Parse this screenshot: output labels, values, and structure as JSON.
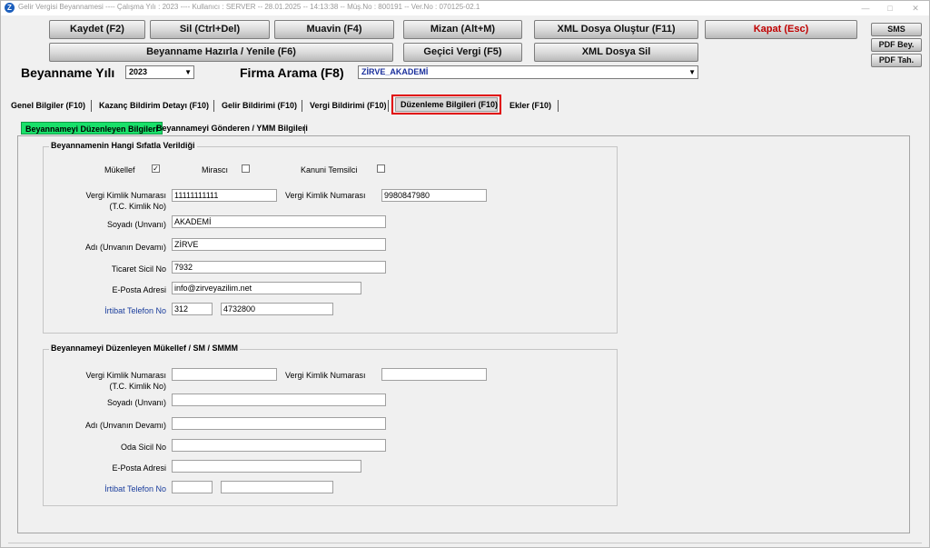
{
  "window": {
    "title": "Gelir Vergisi Beyannamesi  ----  Çalışma Yılı : 2023  ----  Kullanıcı : SERVER -- 28.01.2025 -- 14:13:38 -- Müş.No : 800191 -- Ver.No : 070125-02.1",
    "app_icon": "Z"
  },
  "toolbar": {
    "save": "Kaydet (F2)",
    "delete": "Sil (Ctrl+Del)",
    "muavin": "Muavin (F4)",
    "mizan": "Mizan (Alt+M)",
    "xml_create": "XML Dosya Oluştur (F11)",
    "close": "Kapat (Esc)",
    "prepare": "Beyanname Hazırla / Yenile (F6)",
    "temp_tax": "Geçici Vergi (F5)",
    "xml_delete": "XML Dosya Sil",
    "sms": "SMS",
    "pdf_bey": "PDF Bey.",
    "pdf_tah": "PDF Tah."
  },
  "filters": {
    "year_label": "Beyanname Yılı",
    "year_value": "2023",
    "company_label": "Firma Arama (F8)",
    "company_value": "ZİRVE_AKADEMİ"
  },
  "tabs": [
    "Genel Bilgiler (F10)",
    "Kazanç Bildirim Detayı (F10)",
    "Gelir Bildirimi (F10)",
    "Vergi Bildirimi (F10)",
    "Düzenleme Bilgileri (F10)",
    "Ekler (F10)"
  ],
  "subtabs": [
    "Beyannameyi Düzenleyen Bilgileri",
    "Beyannameyi Gönderen / YMM Bilgileri"
  ],
  "group1": {
    "title": "Beyannamenin Hangi Sıfatla Verildiği",
    "cb_mukellef": "Mükellef",
    "cb_mirasci": "Mirascı",
    "cb_kanuni": "Kanuni Temsilci",
    "mukellef_checked": "✓",
    "vkn_label": "Vergi Kimlik Numarası\n(T.C. Kimlik No)",
    "vkn_label_1": "Vergi Kimlik Numarası",
    "vkn_label_2": "(T.C. Kimlik No)",
    "vkn_value": "11111111111",
    "vkn2_label": "Vergi Kimlik Numarası",
    "vkn2_value": "9980847980",
    "soyadi_label": "Soyadı (Unvanı)",
    "soyadi_value": "AKADEMİ",
    "adi_label": "Adı (Unvanın Devamı)",
    "adi_value": "ZİRVE",
    "ticaret_label": "Ticaret Sicil No",
    "ticaret_value": "7932",
    "eposta_label": "E-Posta Adresi",
    "eposta_value": "info@zirveyazilim.net",
    "tel_label": "İrtibat Telefon No",
    "tel_area": "312",
    "tel_number": "4732800"
  },
  "group2": {
    "title": "Beyannameyi Düzenleyen Mükellef / SM / SMMM",
    "vkn_label_1": "Vergi Kimlik Numarası",
    "vkn_label_2": "(T.C. Kimlik No)",
    "vkn_value": "",
    "vkn2_label": "Vergi Kimlik Numarası",
    "vkn2_value": "",
    "soyadi_label": "Soyadı (Unvanı)",
    "soyadi_value": "",
    "adi_label": "Adı (Unvanın Devamı)",
    "adi_value": "",
    "oda_label": "Oda Sicil No",
    "oda_value": "",
    "eposta_label": "E-Posta Adresi",
    "eposta_value": "",
    "tel_label": "İrtibat Telefon No",
    "tel_area": "",
    "tel_number": ""
  },
  "colors": {
    "active_tab_border": "#e00000",
    "active_subtab_bg": "#19e06a",
    "close_text": "#c00000",
    "company_text": "#1a2f9c"
  }
}
